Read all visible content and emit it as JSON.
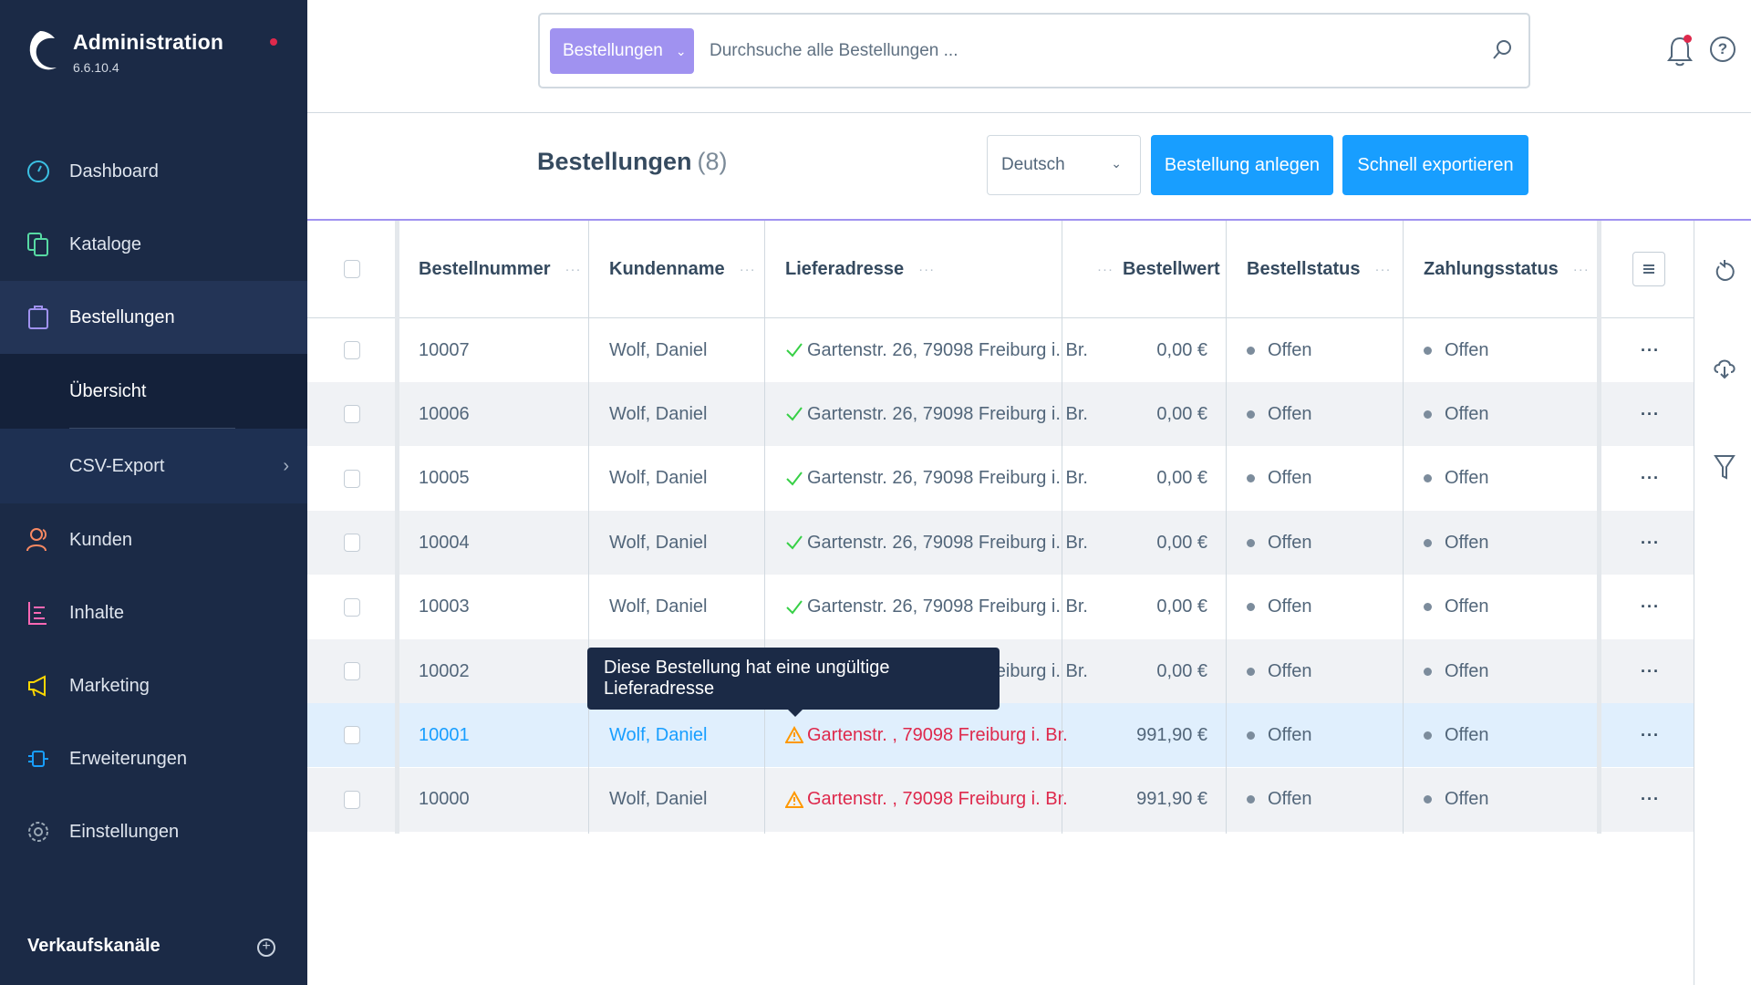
{
  "app": {
    "title": "Administration",
    "version": "6.6.10.4"
  },
  "sidebar": {
    "items": [
      {
        "label": "Dashboard",
        "icon": "dashboard-icon",
        "color": "#3bc0e3"
      },
      {
        "label": "Kataloge",
        "icon": "catalog-icon",
        "color": "#57d9a3"
      },
      {
        "label": "Bestellungen",
        "icon": "orders-icon",
        "color": "#a092f0"
      },
      {
        "label": "Kunden",
        "icon": "customers-icon",
        "color": "#f88962"
      },
      {
        "label": "Inhalte",
        "icon": "content-icon",
        "color": "#ff68b4"
      },
      {
        "label": "Marketing",
        "icon": "marketing-icon",
        "color": "#ffd700"
      },
      {
        "label": "Erweiterungen",
        "icon": "extensions-icon",
        "color": "#189eff"
      },
      {
        "label": "Einstellungen",
        "icon": "settings-icon",
        "color": "#9aa8b5"
      }
    ],
    "sub_items": [
      {
        "label": "Übersicht"
      },
      {
        "label": "CSV-Export"
      }
    ],
    "sales_channels_label": "Verkaufskanäle"
  },
  "search": {
    "type_label": "Bestellungen",
    "placeholder": "Durchsuche alle Bestellungen ..."
  },
  "page": {
    "title": "Bestellungen",
    "count": "(8)",
    "language": "Deutsch",
    "create_label": "Bestellung anlegen",
    "export_label": "Schnell exportieren"
  },
  "table": {
    "columns": [
      "Bestellnummer",
      "Kundenname",
      "Lieferadresse",
      "Bestellwert",
      "Bestellstatus",
      "Zahlungsstatus"
    ],
    "rows": [
      {
        "number": "10007",
        "customer": "Wolf, Daniel",
        "address": "Gartenstr. 26, 79098 Freiburg i. Br.",
        "valid": true,
        "value": "0,00 €",
        "order_status": "Offen",
        "payment_status": "Offen"
      },
      {
        "number": "10006",
        "customer": "Wolf, Daniel",
        "address": "Gartenstr. 26, 79098 Freiburg i. Br.",
        "valid": true,
        "value": "0,00 €",
        "order_status": "Offen",
        "payment_status": "Offen"
      },
      {
        "number": "10005",
        "customer": "Wolf, Daniel",
        "address": "Gartenstr. 26, 79098 Freiburg i. Br.",
        "valid": true,
        "value": "0,00 €",
        "order_status": "Offen",
        "payment_status": "Offen"
      },
      {
        "number": "10004",
        "customer": "Wolf, Daniel",
        "address": "Gartenstr. 26, 79098 Freiburg i. Br.",
        "valid": true,
        "value": "0,00 €",
        "order_status": "Offen",
        "payment_status": "Offen"
      },
      {
        "number": "10003",
        "customer": "Wolf, Daniel",
        "address": "Gartenstr. 26, 79098 Freiburg i. Br.",
        "valid": true,
        "value": "0,00 €",
        "order_status": "Offen",
        "payment_status": "Offen"
      },
      {
        "number": "10002",
        "customer": "Wolf, Daniel",
        "address": "Gartenstr. 26, 79098 Freiburg i. Br.",
        "valid": true,
        "value": "0,00 €",
        "order_status": "Offen",
        "payment_status": "Offen"
      },
      {
        "number": "10001",
        "customer": "Wolf, Daniel",
        "address": "Gartenstr. , 79098 Freiburg i. Br.",
        "valid": false,
        "value": "991,90 €",
        "order_status": "Offen",
        "payment_status": "Offen"
      },
      {
        "number": "10000",
        "customer": "Wolf, Daniel",
        "address": "Gartenstr. , 79098 Freiburg i. Br.",
        "valid": false,
        "value": "991,90 €",
        "order_status": "Offen",
        "payment_status": "Offen"
      }
    ]
  },
  "tooltip": {
    "text": "Diese Bestellung hat eine ungültige Lieferadresse"
  },
  "colors": {
    "sidebar_bg": "#1b2a46",
    "accent": "#189eff",
    "purple": "#a092f0",
    "error": "#de294c",
    "warning": "#ff9800",
    "success": "#37d046"
  }
}
